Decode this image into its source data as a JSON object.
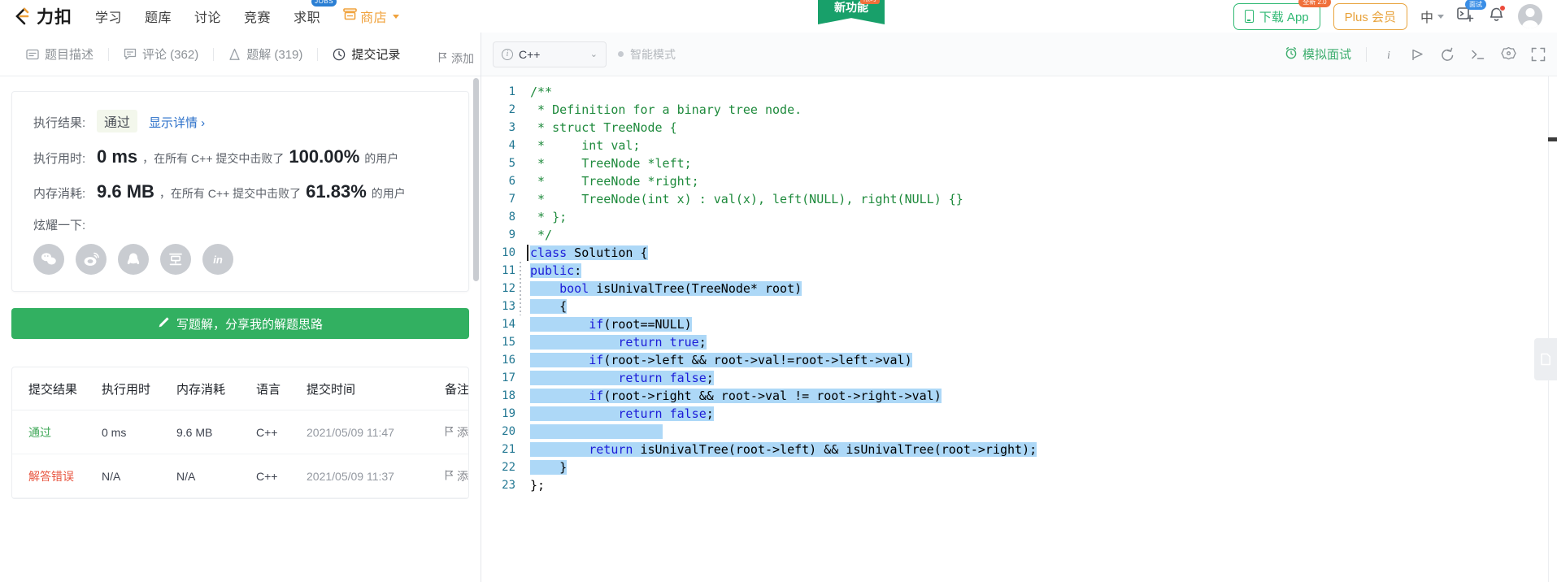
{
  "topnav": {
    "logo_text": "力扣",
    "links": [
      {
        "label": "学习",
        "name": "nav-study"
      },
      {
        "label": "题库",
        "name": "nav-problems"
      },
      {
        "label": "讨论",
        "name": "nav-discuss"
      },
      {
        "label": "竞赛",
        "name": "nav-contest"
      },
      {
        "label": "求职",
        "name": "nav-jobs",
        "badge": "JOBS"
      },
      {
        "label": "商店",
        "name": "nav-store",
        "caret": true
      }
    ],
    "ribbon": "新功能",
    "ribbon_tag": "限时",
    "download_app": "下载 App",
    "download_tag": "全新 2.0",
    "plus_member": "Plus 会员",
    "language": "中",
    "console_tip": "面试",
    "accent_green": "#2eb872",
    "accent_orange": "#e8a33d"
  },
  "left": {
    "tabs": [
      {
        "label": "题目描述",
        "icon": "description-icon",
        "active": false
      },
      {
        "label": "评论 (362)",
        "icon": "comment-icon",
        "active": false
      },
      {
        "label": "题解 (319)",
        "icon": "solution-flask-icon",
        "active": false
      },
      {
        "label": "提交记录",
        "icon": "history-clock-icon",
        "active": true
      }
    ],
    "result": {
      "label": "执行结果:",
      "status": "通过",
      "details_link": "显示详情 ›",
      "add_note": "添加",
      "runtime_label": "执行用时:",
      "runtime_value": "0 ms",
      "runtime_mid": "，在所有 C++ 提交中击败了",
      "runtime_pct": "100.00%",
      "runtime_tail": "的用户",
      "memory_label": "内存消耗:",
      "memory_value": "9.6 MB",
      "memory_mid": "，在所有 C++ 提交中击败了",
      "memory_pct": "61.83%",
      "memory_tail": "的用户",
      "share_label": "炫耀一下:",
      "socials": [
        "wechat-icon",
        "weibo-icon",
        "qq-icon",
        "douban-icon",
        "linkedin-icon"
      ]
    },
    "write_solution_button": "写题解，分享我的解题思路",
    "table": {
      "headers": [
        "提交结果",
        "执行用时",
        "内存消耗",
        "语言",
        "提交时间",
        "备注"
      ],
      "rows": [
        {
          "status": "通过",
          "status_type": "pass",
          "runtime": "0 ms",
          "memory": "9.6 MB",
          "lang": "C++",
          "time": "2021/05/09 11:47",
          "note": "添"
        },
        {
          "status": "解答错误",
          "status_type": "fail",
          "runtime": "N/A",
          "memory": "N/A",
          "lang": "C++",
          "time": "2021/05/09 11:37",
          "note": "添"
        }
      ]
    }
  },
  "editor": {
    "language_selected": "C++",
    "smart_mode": "智能模式",
    "mock_interview": "模拟面试",
    "tools": [
      "info-icon",
      "flag-icon",
      "reset-icon",
      "console-icon",
      "settings-icon",
      "fullscreen-icon"
    ],
    "code_lines": [
      {
        "n": 1,
        "text": "/**",
        "type": "comment",
        "sel": false
      },
      {
        "n": 2,
        "text": " * Definition for a binary tree node.",
        "type": "comment",
        "sel": false
      },
      {
        "n": 3,
        "text": " * struct TreeNode {",
        "type": "comment",
        "sel": false
      },
      {
        "n": 4,
        "text": " *     int val;",
        "type": "comment",
        "sel": false
      },
      {
        "n": 5,
        "text": " *     TreeNode *left;",
        "type": "comment",
        "sel": false
      },
      {
        "n": 6,
        "text": " *     TreeNode *right;",
        "type": "comment",
        "sel": false
      },
      {
        "n": 7,
        "text": " *     TreeNode(int x) : val(x), left(NULL), right(NULL) {}",
        "type": "comment",
        "sel": false
      },
      {
        "n": 8,
        "text": " * };",
        "type": "comment",
        "sel": false
      },
      {
        "n": 9,
        "text": " */",
        "type": "comment",
        "sel": false
      },
      {
        "n": 10,
        "text": "class Solution {",
        "type": "code",
        "sel": true
      },
      {
        "n": 11,
        "text": "public:",
        "type": "code",
        "sel": true
      },
      {
        "n": 12,
        "text": "    bool isUnivalTree(TreeNode* root)",
        "type": "code",
        "sel": true
      },
      {
        "n": 13,
        "text": "    {",
        "type": "code",
        "sel": true
      },
      {
        "n": 14,
        "text": "        if(root==NULL)",
        "type": "code",
        "sel": true
      },
      {
        "n": 15,
        "text": "            return true;",
        "type": "code",
        "sel": true
      },
      {
        "n": 16,
        "text": "        if(root->left && root->val!=root->left->val)",
        "type": "code",
        "sel": true
      },
      {
        "n": 17,
        "text": "            return false;",
        "type": "code",
        "sel": true
      },
      {
        "n": 18,
        "text": "        if(root->right && root->val != root->right->val)",
        "type": "code",
        "sel": true
      },
      {
        "n": 19,
        "text": "            return false;",
        "type": "code",
        "sel": true
      },
      {
        "n": 20,
        "text": "",
        "type": "code",
        "sel": true
      },
      {
        "n": 21,
        "text": "        return isUnivalTree(root->left) && isUnivalTree(root->right);",
        "type": "code",
        "sel": true
      },
      {
        "n": 22,
        "text": "    }",
        "type": "code",
        "sel": true
      },
      {
        "n": 23,
        "text": "};",
        "type": "code",
        "sel": false
      }
    ],
    "selection_color": "#add8f7",
    "comment_color": "#1e8a3c",
    "keyword_color": "#1c1cd8"
  }
}
